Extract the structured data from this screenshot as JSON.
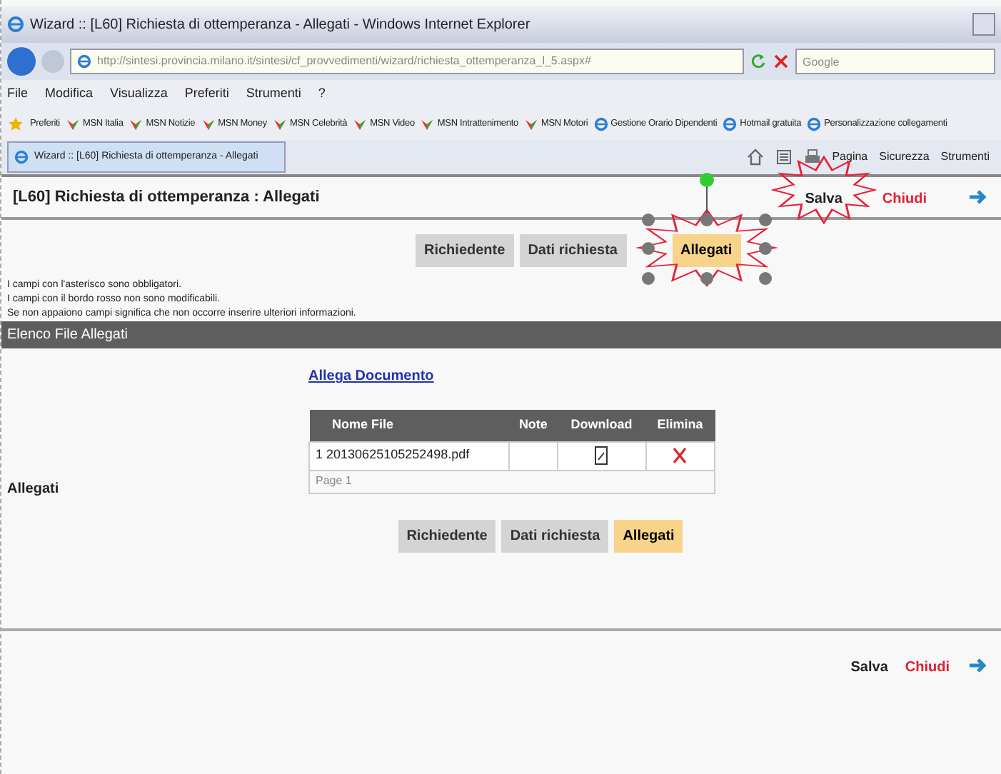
{
  "window": {
    "title": "Wizard :: [L60] Richiesta di ottemperanza - Allegati - Windows Internet Explorer"
  },
  "address_bar": {
    "value": "http://sintesi.provincia.milano.it/sintesi/cf_provvedimenti/wizard/richiesta_ottemperanza_l_5.aspx#"
  },
  "search": {
    "placeholder": "Google"
  },
  "menu": [
    "File",
    "Modifica",
    "Visualizza",
    "Preferiti",
    "Strumenti",
    "?"
  ],
  "favorites_bar": {
    "label": "Preferiti",
    "links": [
      "MSN Italia",
      "MSN Notizie",
      "MSN Money",
      "MSN Celebrità",
      "MSN Video",
      "MSN Intrattenimento",
      "MSN Motori",
      "Gestione Orario Dipendenti",
      "Hotmail gratuita",
      "Personalizzazione collegamenti"
    ]
  },
  "browser_tab": {
    "title": "Wizard :: [L60] Richiesta di ottemperanza - Allegati"
  },
  "command_bar": [
    "Pagina",
    "Sicurezza",
    "Strumenti"
  ],
  "page": {
    "title": "[L60] Richiesta di ottemperanza : Allegati",
    "actions_top": [
      {
        "label": "Salva",
        "kind": "save"
      },
      {
        "label": "Chiudi",
        "kind": "close"
      }
    ],
    "steps_top": [
      {
        "label": "Richiedente",
        "selected": false
      },
      {
        "label": "Dati richiesta",
        "selected": false
      },
      {
        "label": "Allegati",
        "selected": true
      }
    ],
    "notes": [
      "I campi con l'asterisco sono obbligatori.",
      "I campi con il bordo rosso non sono modificabili.",
      "Se non appaiono campi significa che non occorre inserire ulteriori informazioni."
    ],
    "section_header": "Elenco File Allegati",
    "field_label": "Allegati",
    "attach_link": "Allega Documento",
    "table": {
      "columns": [
        "Nome File",
        "Note",
        "Download",
        "Elimina"
      ],
      "rows": [
        {
          "index": "1",
          "file": "20130625105252498.pdf"
        }
      ],
      "pager": "Page 1"
    },
    "steps_bottom": [
      {
        "label": "Richiedente",
        "selected": false
      },
      {
        "label": "Dati richiesta",
        "selected": false
      },
      {
        "label": "Allegati",
        "selected": true
      }
    ],
    "actions_bottom": [
      {
        "label": "Salva",
        "kind": "save"
      },
      {
        "label": "Chiudi",
        "kind": "close"
      }
    ]
  }
}
